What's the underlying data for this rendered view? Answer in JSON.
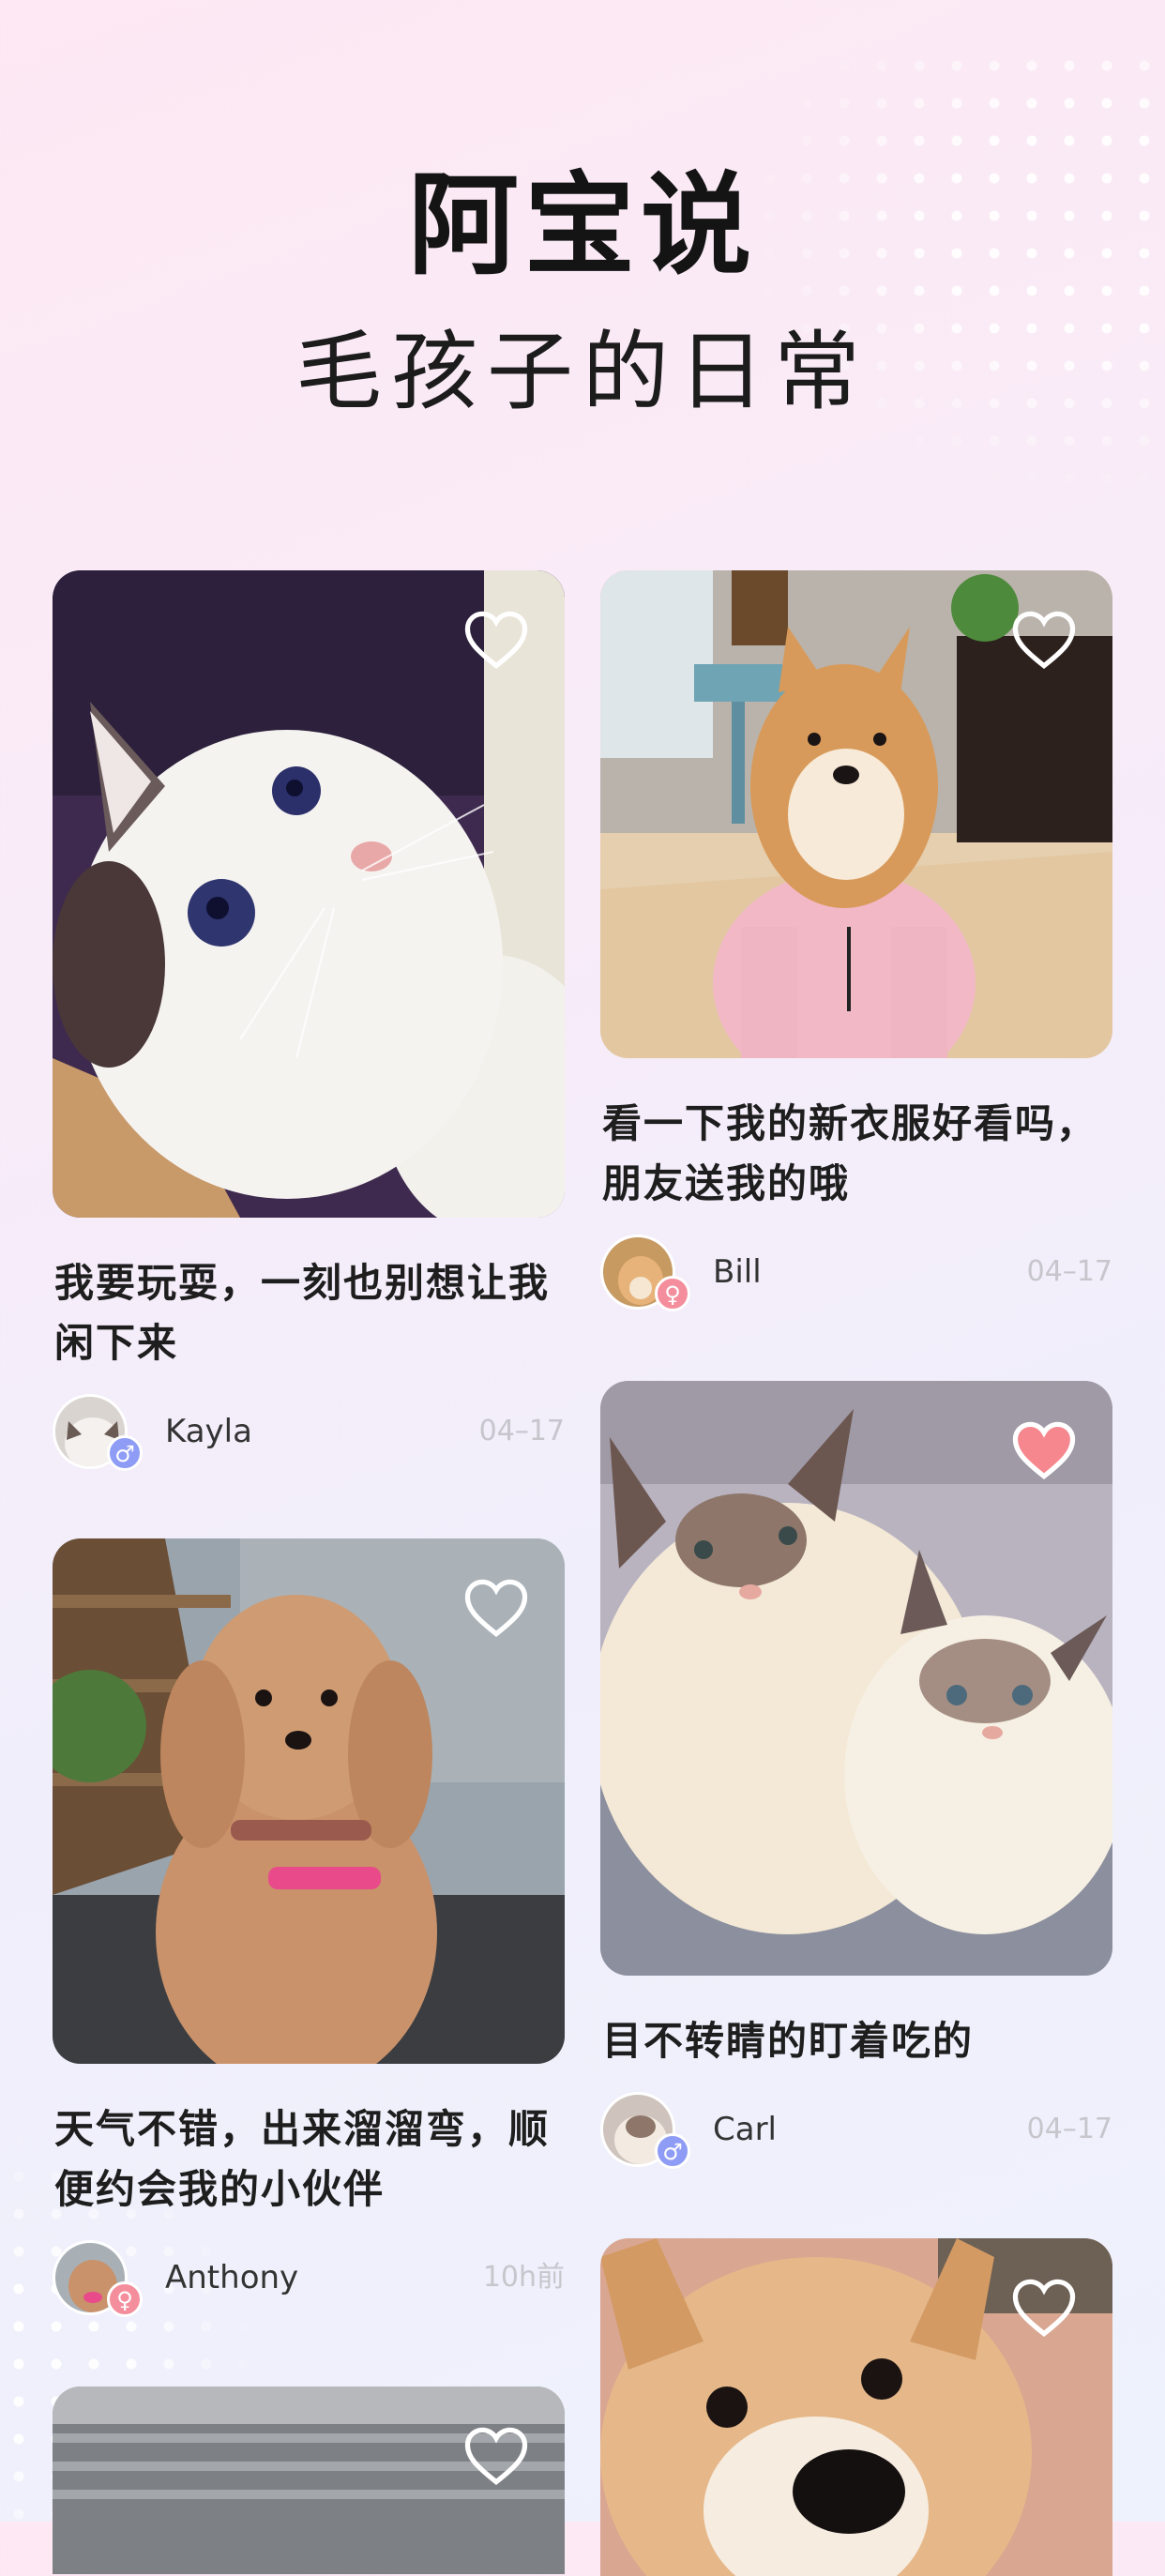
{
  "header": {
    "title": "阿宝说",
    "subtitle": "毛孩子的日常"
  },
  "posts": [
    {
      "caption": "我要玩耍，一刻也别想让我闲下来",
      "user": "Kayla",
      "gender": "♂",
      "date": "04–17",
      "liked": false,
      "photo": "ragdoll-kitten-photo"
    },
    {
      "caption": "看一下我的新衣服好看吗，朋友送我的哦",
      "user": "Bill",
      "gender": "♀",
      "date": "04–17",
      "liked": false,
      "photo": "shiba-in-pink-sweater-photo"
    },
    {
      "caption": "目不转睛的盯着吃的",
      "user": "Carl",
      "gender": "♂",
      "date": "04–17",
      "liked": true,
      "photo": "two-ragdoll-cats-photo"
    },
    {
      "caption": "天气不错，出来溜溜弯，顺便约会我的小伙伴",
      "user": "Anthony",
      "gender": "♀",
      "date": "10h前",
      "liked": false,
      "photo": "poodle-on-street-photo"
    },
    {
      "caption": "",
      "user": "",
      "gender": "",
      "date": "",
      "liked": false,
      "photo": "partial-photo"
    },
    {
      "caption": "",
      "user": "",
      "gender": "",
      "date": "",
      "liked": false,
      "photo": "shiba-closeup-photo"
    }
  ],
  "colors": {
    "like_active": "#f6878f",
    "badge_male": "#8e9cf5",
    "badge_female": "#f48e9c"
  }
}
